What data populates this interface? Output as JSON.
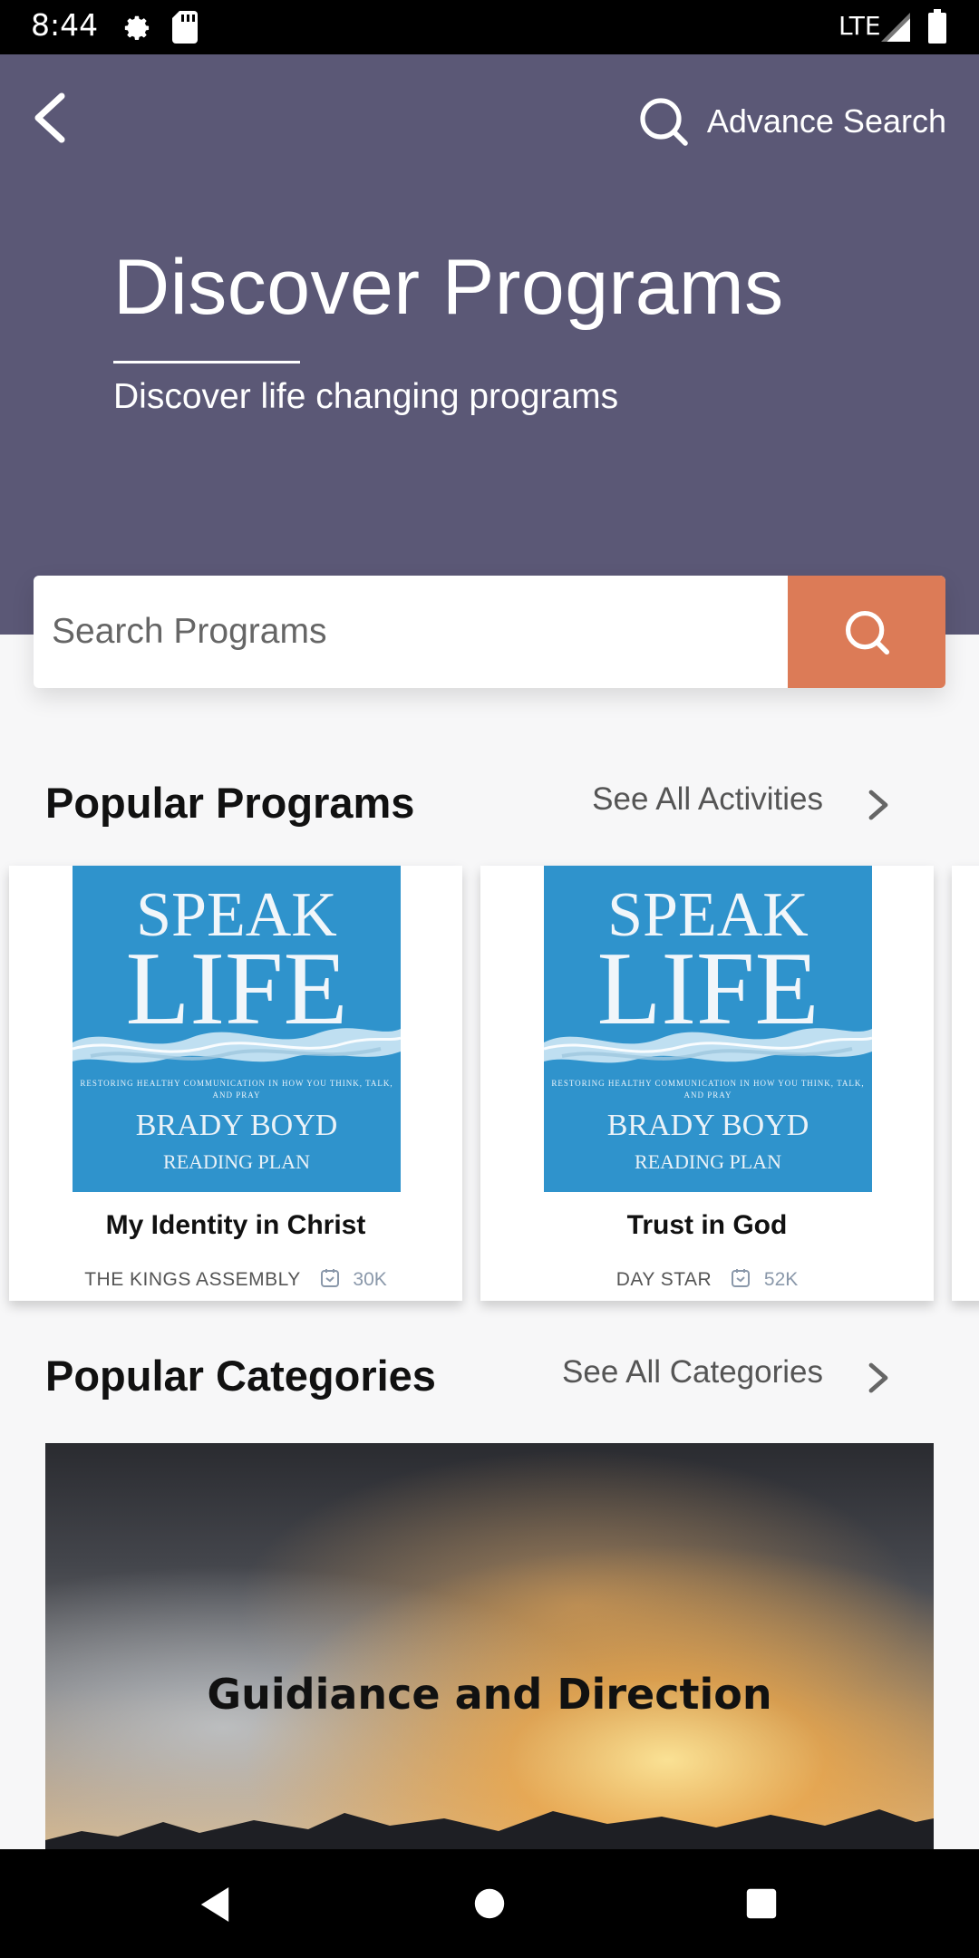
{
  "status_bar": {
    "time": "8:44",
    "network": "LTE",
    "icons": [
      "gear-icon",
      "sd-card-icon",
      "signal-icon",
      "battery-icon"
    ]
  },
  "header": {
    "back_icon": "chevron-left-icon",
    "advance_search_label": "Advance Search",
    "title": "Discover Programs",
    "subtitle": "Discover life changing programs",
    "background_color": "#5b5876"
  },
  "search": {
    "placeholder": "Search Programs",
    "button_color": "#dc7b57"
  },
  "popular_programs": {
    "title": "Popular Programs",
    "see_all_label": "See All Activities",
    "items": [
      {
        "name": "My Identity in Christ",
        "organization": "THE KINGS ASSEMBLY",
        "count": "30K",
        "cover": {
          "line1": "SPEAK",
          "line2": "LIFE",
          "tagline": "RESTORING HEALTHY COMMUNICATION IN HOW YOU THINK, TALK, AND PRAY",
          "author": "BRADY BOYD",
          "subtitle": "READING PLAN"
        }
      },
      {
        "name": "Trust in God",
        "organization": "DAY STAR",
        "count": "52K",
        "cover": {
          "line1": "SPEAK",
          "line2": "LIFE",
          "tagline": "RESTORING HEALTHY COMMUNICATION IN HOW YOU THINK, TALK, AND PRAY",
          "author": "BRADY BOYD",
          "subtitle": "READING PLAN"
        }
      }
    ]
  },
  "popular_categories": {
    "title": "Popular Categories",
    "see_all_label": "See All Categories",
    "items": [
      {
        "name": "Guidiance and Direction"
      }
    ]
  },
  "nav_bar": {
    "icons": [
      "nav-back-icon",
      "nav-home-icon",
      "nav-recents-icon"
    ]
  }
}
